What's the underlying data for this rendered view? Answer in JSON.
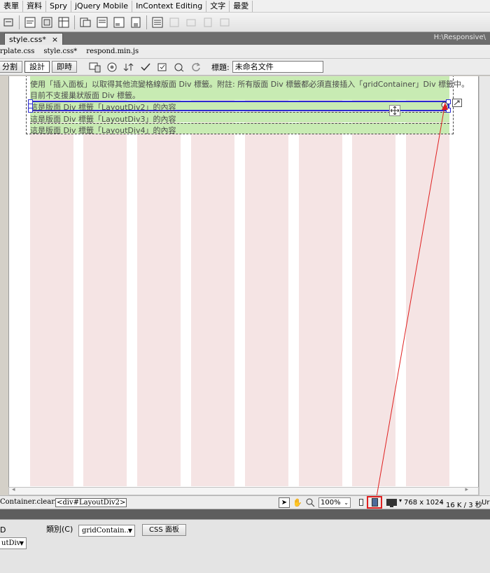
{
  "menu": [
    "表單",
    "資料",
    "Spry",
    "jQuery Mobile",
    "InContext Editing",
    "文字",
    "最愛"
  ],
  "doc_tab": {
    "label": "style.css*",
    "close": "×"
  },
  "doc_path": "H:\\Responsive\\",
  "related_files": [
    "rplate.css",
    "style.css*",
    "respond.min.js"
  ],
  "view_buttons": {
    "split": "分割",
    "design": "設計",
    "live": "即時"
  },
  "title": {
    "label": "標題:",
    "value": "未命名文件"
  },
  "design": {
    "intro_line1": "使用「插入面板」以取得其他流變格線版面 Div 標籤。附註: 所有版面 Div 標籤都必須直接插入「gridContainer」Div 標籤中。",
    "intro_line2": "目前不支援巢狀版面 Div 標籤。",
    "div2_text": "這是版面 Div 標籤「LayoutDiv2」的內容",
    "div3_text": "這是版面 Div 標籤「LayoutDiv3」的內容",
    "div4_text": "這是版面 Div 標籤「LayoutDiv4」的內容"
  },
  "status": {
    "tag1": "Container.clearfix>",
    "tag2": "<div#LayoutDiv2>",
    "zoom": "100%",
    "window_size": "768 x 1024",
    "doc_size": "16 K / 3 秒",
    "encoding": "Ur"
  },
  "props": {
    "id_label": "D",
    "class_label": "類別(C)",
    "class_value": "gridContain...",
    "css_button": "CSS 面板",
    "id_value": "utDiv"
  },
  "colors": {
    "column": "#f5e4e4",
    "layout_div": "#c8ebb3",
    "selection": "#2a2acf",
    "annotation": "#e02020"
  }
}
